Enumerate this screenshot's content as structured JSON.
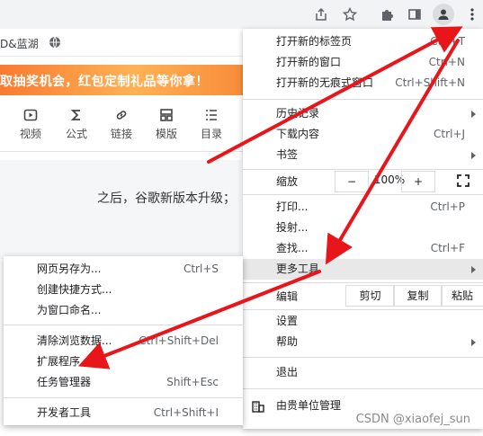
{
  "bookmark_bar": {
    "text": "D&蓝湖"
  },
  "banner": {
    "text": "取抽奖机会，红包定制礼品等你拿！"
  },
  "editor_toolbar": {
    "items": [
      {
        "label": "视频",
        "icon": "video-icon"
      },
      {
        "label": "公式",
        "icon": "sigma-icon"
      },
      {
        "label": "链接",
        "icon": "link-icon"
      },
      {
        "label": "模版",
        "icon": "template-icon"
      },
      {
        "label": "目录",
        "icon": "list-icon"
      }
    ]
  },
  "page_text": "之后，谷歌新版本升级；",
  "menu": {
    "new_tab": {
      "label": "打开新的标签页",
      "shortcut": "Ctrl+T"
    },
    "new_window": {
      "label": "打开新的窗口",
      "shortcut": "Ctrl+N"
    },
    "new_incognito": {
      "label": "打开新的无痕式窗口",
      "shortcut": "Ctrl+Shift+N"
    },
    "history": {
      "label": "历史记录"
    },
    "downloads": {
      "label": "下载内容",
      "shortcut": "Ctrl+J"
    },
    "bookmarks": {
      "label": "书签"
    },
    "zoom": {
      "label": "缩放",
      "minus": "−",
      "value": "100%",
      "plus": "+"
    },
    "print": {
      "label": "打印...",
      "shortcut": "Ctrl+P"
    },
    "cast": {
      "label": "投射..."
    },
    "find": {
      "label": "查找...",
      "shortcut": "Ctrl+F"
    },
    "more_tools": {
      "label": "更多工具"
    },
    "edit": {
      "label": "编辑",
      "cut": "剪切",
      "copy": "复制",
      "paste": "粘贴"
    },
    "settings": {
      "label": "设置"
    },
    "help": {
      "label": "帮助"
    },
    "exit": {
      "label": "退出"
    },
    "managed": {
      "label": "由贵单位管理"
    }
  },
  "submenu": {
    "save_as": {
      "label": "网页另存为...",
      "shortcut": "Ctrl+S"
    },
    "create_shortcut": {
      "label": "创建快捷方式..."
    },
    "name_window": {
      "label": "为窗口命名..."
    },
    "clear_data": {
      "label": "清除浏览数据...",
      "shortcut": "Ctrl+Shift+Del"
    },
    "extensions": {
      "label": "扩展程序"
    },
    "task_manager": {
      "label": "任务管理器",
      "shortcut": "Shift+Esc"
    },
    "dev_tools": {
      "label": "开发者工具",
      "shortcut": "Ctrl+Shift+I"
    }
  },
  "watermark": "CSDN @xiaofej_sun",
  "colors": {
    "annotation_arrow": "#e8161b",
    "banner": "#f98a3a",
    "highlight": "#e8e8e8"
  }
}
